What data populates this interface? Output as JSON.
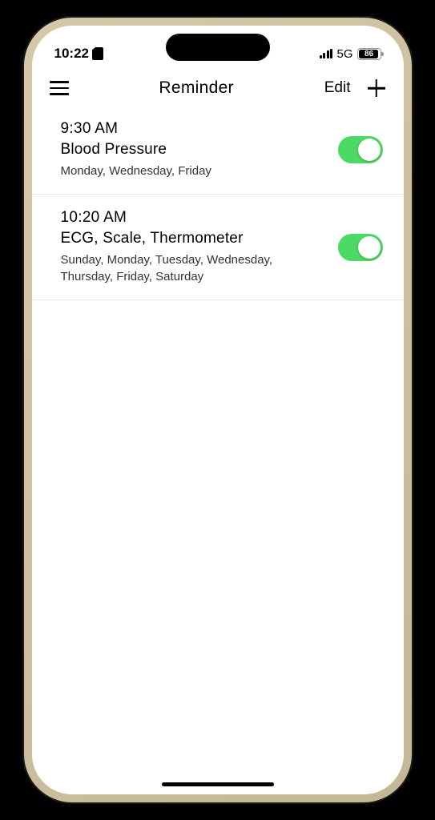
{
  "status": {
    "time": "10:22",
    "network": "5G",
    "battery_pct": "86"
  },
  "header": {
    "title": "Reminder",
    "edit_label": "Edit"
  },
  "reminders": [
    {
      "time": "9:30 AM",
      "label": "Blood Pressure",
      "days": "Monday, Wednesday, Friday",
      "enabled": true
    },
    {
      "time": "10:20 AM",
      "label": "ECG, Scale, Thermometer",
      "days": "Sunday, Monday, Tuesday, Wednesday, Thursday, Friday, Saturday",
      "enabled": true
    }
  ],
  "colors": {
    "toggle_on": "#4cd964"
  }
}
